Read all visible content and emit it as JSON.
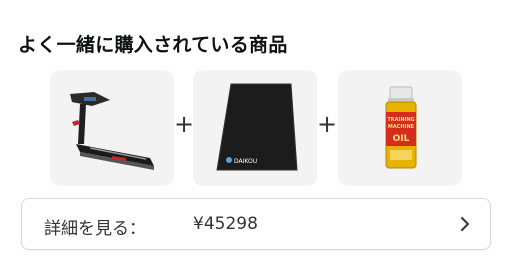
{
  "section": {
    "title": "よく一緒に購入されている商品"
  },
  "bundle": {
    "items": [
      {
        "icon": "treadmill-image"
      },
      {
        "icon": "floor-mat-image",
        "mat_brand": "DAIKOU"
      },
      {
        "icon": "oil-can-image",
        "can_label_lines": [
          "TRAINING",
          "MACHINE",
          "OIL"
        ]
      }
    ],
    "plus_symbol": "+"
  },
  "detail_button": {
    "label": "詳細を見る：",
    "price": "¥45298",
    "chevron_icon": "chevron-right-icon"
  },
  "colors": {
    "tile_bg": "#f3f3f3",
    "can_yellow": "#e8b300",
    "can_red": "#d62b1e"
  }
}
